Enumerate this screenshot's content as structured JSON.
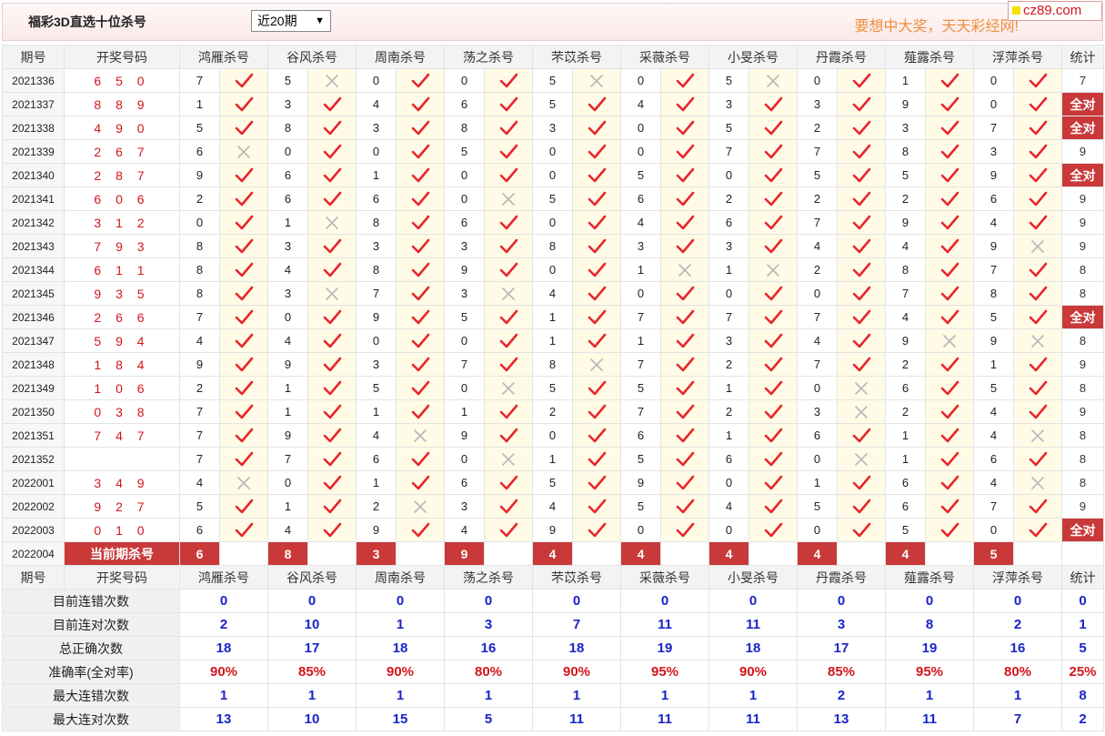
{
  "header": {
    "title": "福彩3D直选十位杀号",
    "range_select": "近20期",
    "slogan": "要想中大奖，天天彩经网!",
    "logo": "cz89.com"
  },
  "columns": {
    "period": "期号",
    "draw": "开奖号码",
    "experts": [
      "鸿雁杀号",
      "谷风杀号",
      "周南杀号",
      "荡之杀号",
      "芣苡杀号",
      "采薇杀号",
      "小旻杀号",
      "丹霞杀号",
      "薤露杀号",
      "浮萍杀号"
    ],
    "stat": "统计"
  },
  "rows": [
    {
      "period": "2021336",
      "draw": "6 5 0",
      "kills": [
        7,
        5,
        0,
        0,
        5,
        0,
        5,
        0,
        1,
        0
      ],
      "ok": [
        1,
        0,
        1,
        1,
        0,
        1,
        0,
        1,
        1,
        1
      ],
      "stat": "7"
    },
    {
      "period": "2021337",
      "draw": "8 8 9",
      "kills": [
        1,
        3,
        4,
        6,
        5,
        4,
        3,
        3,
        9,
        0
      ],
      "ok": [
        1,
        1,
        1,
        1,
        1,
        1,
        1,
        1,
        1,
        1
      ],
      "stat": "全对"
    },
    {
      "period": "2021338",
      "draw": "4 9 0",
      "kills": [
        5,
        8,
        3,
        8,
        3,
        0,
        5,
        2,
        3,
        7
      ],
      "ok": [
        1,
        1,
        1,
        1,
        1,
        1,
        1,
        1,
        1,
        1
      ],
      "stat": "全对"
    },
    {
      "period": "2021339",
      "draw": "2 6 7",
      "kills": [
        6,
        0,
        0,
        5,
        0,
        0,
        7,
        7,
        8,
        3
      ],
      "ok": [
        0,
        1,
        1,
        1,
        1,
        1,
        1,
        1,
        1,
        1
      ],
      "stat": "9"
    },
    {
      "period": "2021340",
      "draw": "2 8 7",
      "kills": [
        9,
        6,
        1,
        0,
        0,
        5,
        0,
        5,
        5,
        9
      ],
      "ok": [
        1,
        1,
        1,
        1,
        1,
        1,
        1,
        1,
        1,
        1
      ],
      "stat": "全对"
    },
    {
      "period": "2021341",
      "draw": "6 0 6",
      "kills": [
        2,
        6,
        6,
        0,
        5,
        6,
        2,
        2,
        2,
        6
      ],
      "ok": [
        1,
        1,
        1,
        0,
        1,
        1,
        1,
        1,
        1,
        1
      ],
      "stat": "9"
    },
    {
      "period": "2021342",
      "draw": "3 1 2",
      "kills": [
        0,
        1,
        8,
        6,
        0,
        4,
        6,
        7,
        9,
        4
      ],
      "ok": [
        1,
        0,
        1,
        1,
        1,
        1,
        1,
        1,
        1,
        1
      ],
      "stat": "9"
    },
    {
      "period": "2021343",
      "draw": "7 9 3",
      "kills": [
        8,
        3,
        3,
        3,
        8,
        3,
        3,
        4,
        4,
        9
      ],
      "ok": [
        1,
        1,
        1,
        1,
        1,
        1,
        1,
        1,
        1,
        0
      ],
      "stat": "9"
    },
    {
      "period": "2021344",
      "draw": "6 1 1",
      "kills": [
        8,
        4,
        8,
        9,
        0,
        1,
        1,
        2,
        8,
        7
      ],
      "ok": [
        1,
        1,
        1,
        1,
        1,
        0,
        0,
        1,
        1,
        1
      ],
      "stat": "8"
    },
    {
      "period": "2021345",
      "draw": "9 3 5",
      "kills": [
        8,
        3,
        7,
        3,
        4,
        0,
        0,
        0,
        7,
        8
      ],
      "ok": [
        1,
        0,
        1,
        0,
        1,
        1,
        1,
        1,
        1,
        1
      ],
      "stat": "8"
    },
    {
      "period": "2021346",
      "draw": "2 6 6",
      "kills": [
        7,
        0,
        9,
        5,
        1,
        7,
        7,
        7,
        4,
        5
      ],
      "ok": [
        1,
        1,
        1,
        1,
        1,
        1,
        1,
        1,
        1,
        1
      ],
      "stat": "全对"
    },
    {
      "period": "2021347",
      "draw": "5 9 4",
      "kills": [
        4,
        4,
        0,
        0,
        1,
        1,
        3,
        4,
        9,
        9
      ],
      "ok": [
        1,
        1,
        1,
        1,
        1,
        1,
        1,
        1,
        0,
        0
      ],
      "stat": "8"
    },
    {
      "period": "2021348",
      "draw": "1 8 4",
      "kills": [
        9,
        9,
        3,
        7,
        8,
        7,
        2,
        7,
        2,
        1
      ],
      "ok": [
        1,
        1,
        1,
        1,
        0,
        1,
        1,
        1,
        1,
        1
      ],
      "stat": "9"
    },
    {
      "period": "2021349",
      "draw": "1 0 6",
      "kills": [
        2,
        1,
        5,
        0,
        5,
        5,
        1,
        0,
        6,
        5
      ],
      "ok": [
        1,
        1,
        1,
        0,
        1,
        1,
        1,
        0,
        1,
        1
      ],
      "stat": "8"
    },
    {
      "period": "2021350",
      "draw": "0 3 8",
      "kills": [
        7,
        1,
        1,
        1,
        2,
        7,
        2,
        3,
        2,
        4
      ],
      "ok": [
        1,
        1,
        1,
        1,
        1,
        1,
        1,
        0,
        1,
        1
      ],
      "stat": "9"
    },
    {
      "period": "2021351",
      "draw": "7 4 7",
      "kills": [
        7,
        9,
        4,
        9,
        0,
        6,
        1,
        6,
        1,
        4
      ],
      "ok": [
        1,
        1,
        0,
        1,
        1,
        1,
        1,
        1,
        1,
        0
      ],
      "stat": "8"
    },
    {
      "period": "2021352",
      "draw": "",
      "kills": [
        7,
        7,
        6,
        0,
        1,
        5,
        6,
        0,
        1,
        6
      ],
      "ok": [
        1,
        1,
        1,
        0,
        1,
        1,
        1,
        0,
        1,
        1
      ],
      "stat": "8"
    },
    {
      "period": "2022001",
      "draw": "3 4 9",
      "kills": [
        4,
        0,
        1,
        6,
        5,
        9,
        0,
        1,
        6,
        4
      ],
      "ok": [
        0,
        1,
        1,
        1,
        1,
        1,
        1,
        1,
        1,
        0
      ],
      "stat": "8"
    },
    {
      "period": "2022002",
      "draw": "9 2 7",
      "kills": [
        5,
        1,
        2,
        3,
        4,
        5,
        4,
        5,
        6,
        7
      ],
      "ok": [
        1,
        1,
        0,
        1,
        1,
        1,
        1,
        1,
        1,
        1
      ],
      "stat": "9"
    },
    {
      "period": "2022003",
      "draw": "0 1 0",
      "kills": [
        6,
        4,
        9,
        4,
        9,
        0,
        0,
        0,
        5,
        0
      ],
      "ok": [
        1,
        1,
        1,
        1,
        1,
        1,
        1,
        1,
        1,
        1
      ],
      "stat": "全对"
    }
  ],
  "current": {
    "period": "2022004",
    "label": "当前期杀号",
    "kills": [
      "6",
      "8",
      "3",
      "9",
      "4",
      "4",
      "4",
      "4",
      "4",
      "5"
    ]
  },
  "stats": [
    {
      "label": "目前连错次数",
      "values": [
        "0",
        "0",
        "0",
        "0",
        "0",
        "0",
        "0",
        "0",
        "0",
        "0"
      ],
      "stat": "0",
      "style": "num"
    },
    {
      "label": "目前连对次数",
      "values": [
        "2",
        "10",
        "1",
        "3",
        "7",
        "11",
        "11",
        "3",
        "8",
        "2"
      ],
      "stat": "1",
      "style": "num"
    },
    {
      "label": "总正确次数",
      "values": [
        "18",
        "17",
        "18",
        "16",
        "18",
        "19",
        "18",
        "17",
        "19",
        "16"
      ],
      "stat": "5",
      "style": "num"
    },
    {
      "label": "准确率(全对率)",
      "values": [
        "90%",
        "85%",
        "90%",
        "80%",
        "90%",
        "95%",
        "90%",
        "85%",
        "95%",
        "80%"
      ],
      "stat": "25%",
      "style": "pct"
    },
    {
      "label": "最大连错次数",
      "values": [
        "1",
        "1",
        "1",
        "1",
        "1",
        "1",
        "1",
        "2",
        "1",
        "1"
      ],
      "stat": "8",
      "style": "num"
    },
    {
      "label": "最大连对次数",
      "values": [
        "13",
        "10",
        "15",
        "5",
        "11",
        "11",
        "11",
        "13",
        "11",
        "7"
      ],
      "stat": "2",
      "style": "num"
    }
  ],
  "colors": {
    "accent": "#c9393a",
    "check": "#e8262d",
    "cross": "#b8b8b8",
    "stat_blue": "#1a23c8",
    "draw_red": "#d3151c"
  }
}
